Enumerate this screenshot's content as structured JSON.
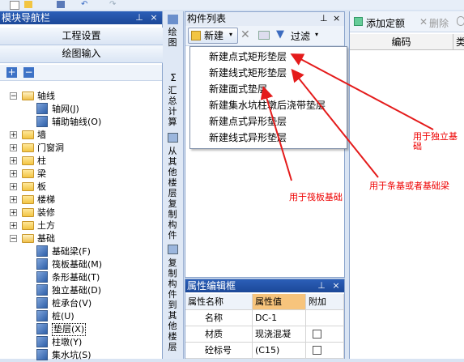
{
  "toolbar": {
    "icons": [
      "new-file-icon",
      "open-folder-icon",
      "save-icon",
      "undo-icon",
      "redo-icon"
    ]
  },
  "left_panel": {
    "title": "模块导航栏",
    "buttons": [
      "工程设置",
      "绘图输入"
    ],
    "tree": [
      {
        "label": "轴线",
        "level": 0,
        "expanded": true
      },
      {
        "label": "轴网(J)",
        "level": 1,
        "icon": "axis-grid-icon"
      },
      {
        "label": "辅助轴线(O)",
        "level": 1,
        "icon": "aux-axis-icon"
      },
      {
        "label": "墙",
        "level": 0,
        "expanded": false
      },
      {
        "label": "门窗洞",
        "level": 0,
        "expanded": false
      },
      {
        "label": "柱",
        "level": 0,
        "expanded": false
      },
      {
        "label": "梁",
        "level": 0,
        "expanded": false
      },
      {
        "label": "板",
        "level": 0,
        "expanded": false
      },
      {
        "label": "楼梯",
        "level": 0,
        "expanded": false
      },
      {
        "label": "装修",
        "level": 0,
        "expanded": false
      },
      {
        "label": "土方",
        "level": 0,
        "expanded": false
      },
      {
        "label": "基础",
        "level": 0,
        "expanded": true
      },
      {
        "label": "基础梁(F)",
        "level": 1,
        "icon": "foundation-beam-icon"
      },
      {
        "label": "筏板基础(M)",
        "level": 1,
        "icon": "raft-foundation-icon"
      },
      {
        "label": "条形基础(T)",
        "level": 1,
        "icon": "strip-foundation-icon"
      },
      {
        "label": "独立基础(D)",
        "level": 1,
        "icon": "isolated-foundation-icon"
      },
      {
        "label": "桩承台(V)",
        "level": 1,
        "icon": "pile-cap-icon"
      },
      {
        "label": "桩(U)",
        "level": 1,
        "icon": "pile-icon"
      },
      {
        "label": "垫层(X)",
        "level": 1,
        "icon": "cushion-icon",
        "selected": true
      },
      {
        "label": "柱墩(Y)",
        "level": 1,
        "icon": "column-pier-icon"
      },
      {
        "label": "集水坑(S)",
        "level": 1,
        "icon": "sump-pit-icon"
      }
    ]
  },
  "vstrip": {
    "items": [
      {
        "label": "绘图",
        "icon": "draw-icon"
      },
      {
        "label": "汇总计算",
        "icon": "sigma-icon"
      },
      {
        "label": "从其他楼层复制构件",
        "icon": "copy-from-icon"
      },
      {
        "label": "复制构件到其他楼层",
        "icon": "copy-to-icon"
      }
    ]
  },
  "component_list": {
    "title": "构件列表",
    "new_label": "新建",
    "filter_label": "过滤",
    "menu": [
      "新建点式矩形垫层",
      "新建线式矩形垫层",
      "新建面式垫层",
      "新建集水坑柱墩后浇带垫层",
      "新建点式异形垫层",
      "新建线式异形垫层"
    ]
  },
  "properties": {
    "title": "属性编辑框",
    "headers": [
      "属性名称",
      "属性值",
      "附加"
    ],
    "rows": [
      {
        "name": "名称",
        "value": "DC-1",
        "checkbox": false
      },
      {
        "name": "材质",
        "value": "现浇混凝",
        "checkbox": true
      },
      {
        "name": "砼标号",
        "value": "(C15)",
        "checkbox": true
      }
    ]
  },
  "right_panel": {
    "add_label": "添加定额",
    "delete_label": "删除",
    "col_code": "编码",
    "col_type": "类"
  },
  "annotations": {
    "raft": "用于筏板基础",
    "strip": "用于条基或者基础梁",
    "isolated_line1": "用于独立基",
    "isolated_line2": "础"
  },
  "colors": {
    "arrow": "#e41b1b",
    "titlebar": "#2352a8",
    "annotation": "#ee0000"
  }
}
